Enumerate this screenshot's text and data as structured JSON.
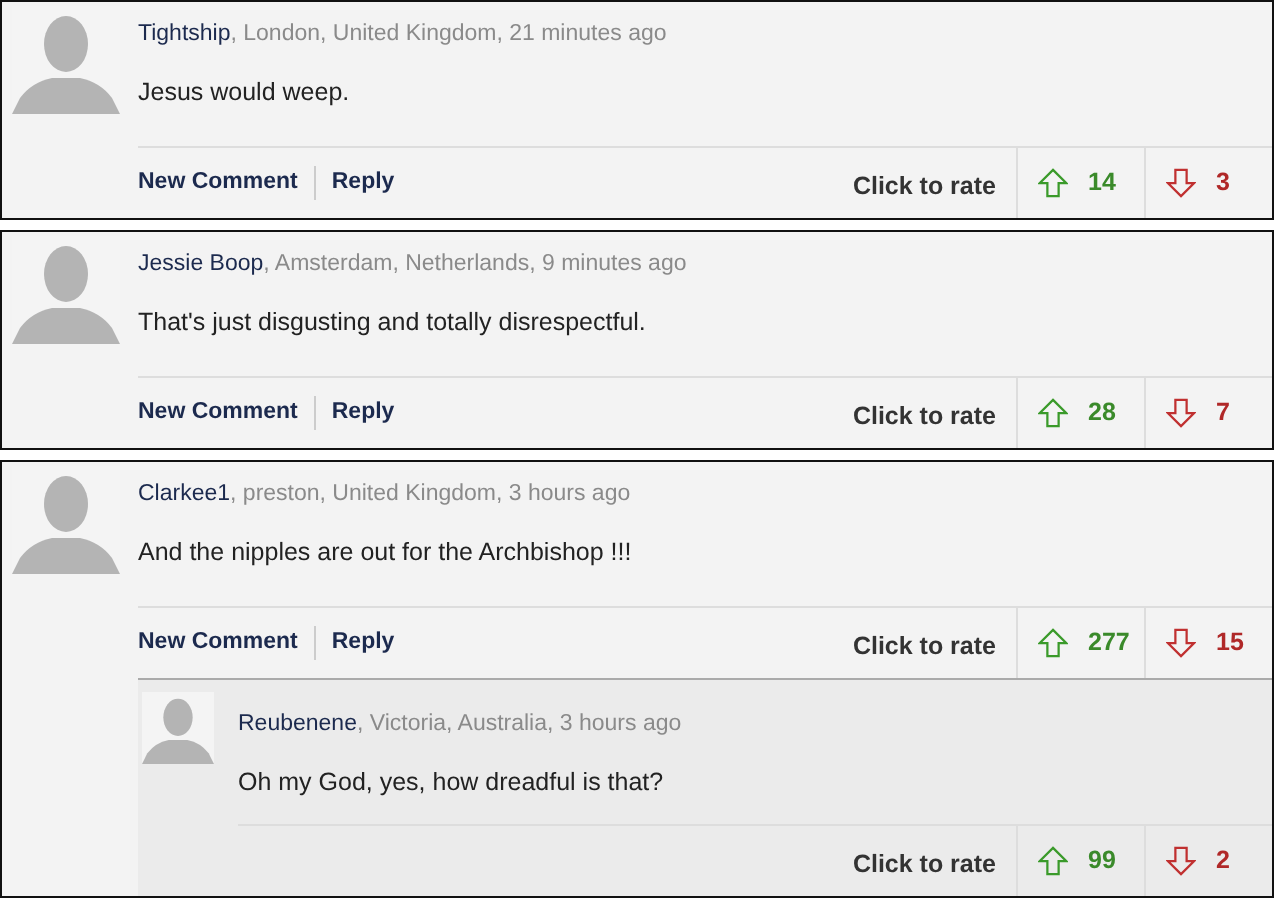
{
  "comments": [
    {
      "author": "Tightship",
      "meta": ", London, United Kingdom, 21 minutes ago",
      "text": "Jesus would weep.",
      "actions": [
        "New Comment",
        "Reply"
      ],
      "rate_label": "Click to rate",
      "up": "14",
      "down": "3"
    },
    {
      "author": "Jessie Boop",
      "meta": ", Amsterdam, Netherlands, 9 minutes ago",
      "text": "That's just disgusting and totally disrespectful.",
      "actions": [
        "New Comment",
        "Reply"
      ],
      "rate_label": "Click to rate",
      "up": "28",
      "down": "7"
    },
    {
      "author": "Clarkee1",
      "meta": ", preston, United Kingdom, 3 hours ago",
      "text": "And the nipples are out for the Archbishop !!!",
      "actions": [
        "New Comment",
        "Reply"
      ],
      "rate_label": "Click to rate",
      "up": "277",
      "down": "15",
      "replies": [
        {
          "author": "Reubenene",
          "meta": ", Victoria, Australia, 3 hours ago",
          "text": "Oh my God, yes, how dreadful is that?",
          "rate_label": "Click to rate",
          "up": "99",
          "down": "2"
        }
      ]
    }
  ]
}
